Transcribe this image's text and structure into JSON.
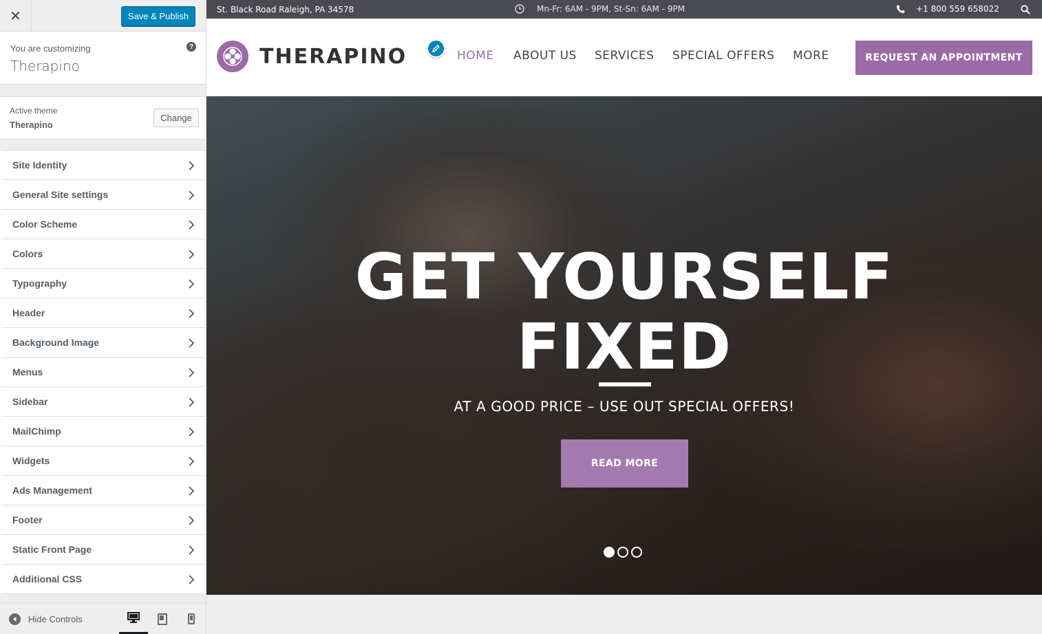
{
  "customizer": {
    "close_label": "✕",
    "save_label": "Save & Publish",
    "you_are_customizing": "You are customizing",
    "site_name": "Therapino",
    "help_label": "?",
    "active_theme_label": "Active theme",
    "active_theme_name": "Therapino",
    "change_label": "Change",
    "sections": [
      {
        "label": "Site Identity"
      },
      {
        "label": "General Site settings"
      },
      {
        "label": "Color Scheme"
      },
      {
        "label": "Colors"
      },
      {
        "label": "Typography"
      },
      {
        "label": "Header"
      },
      {
        "label": "Background Image"
      },
      {
        "label": "Menus"
      },
      {
        "label": "Sidebar"
      },
      {
        "label": "MailChimp"
      },
      {
        "label": "Widgets"
      },
      {
        "label": "Ads Management"
      },
      {
        "label": "Footer"
      },
      {
        "label": "Static Front Page"
      },
      {
        "label": "Additional CSS"
      }
    ],
    "hide_controls_label": "Hide Controls",
    "devices": {
      "active": "desktop",
      "options": [
        "desktop",
        "tablet",
        "mobile"
      ]
    }
  },
  "preview": {
    "topbar": {
      "address": "St. Black Road Raleigh, PA 34578",
      "hours": "Mn-Fr: 6AM - 9PM, St-Sn: 6AM - 9PM",
      "phone": "+1 800 559 658022"
    },
    "brand": "THERAPINO",
    "nav": {
      "home": "HOME",
      "about": "ABOUT US",
      "services": "SERVICES",
      "offers": "SPECIAL OFFERS",
      "more": "MORE"
    },
    "cta_label": "REQUEST AN APPOINTMENT",
    "hero": {
      "title_line1": "GET YOURSELF",
      "title_line2": "FIXED",
      "subtitle": "AT A GOOD PRICE – USE OUT SPECIAL OFFERS!",
      "button_label": "READ MORE",
      "slides": 3,
      "active_slide": 1
    }
  },
  "colors": {
    "accent_purple": "#9b6ba8",
    "wp_primary_blue": "#0085ba",
    "topbar_bg": "#4a4a52"
  }
}
